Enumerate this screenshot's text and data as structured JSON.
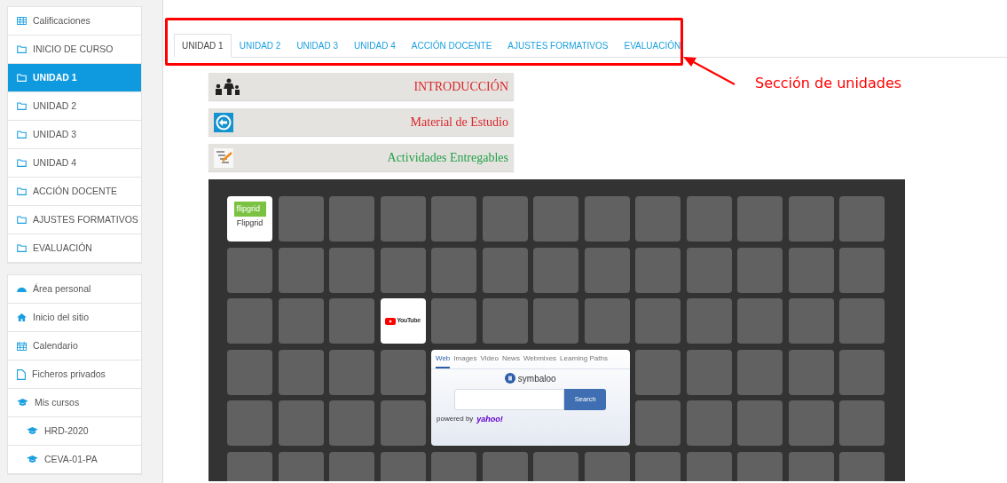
{
  "sidebar": {
    "groups": [
      {
        "items": [
          {
            "kind": "table",
            "label": "Calificaciones",
            "selected": false
          },
          {
            "kind": "folder",
            "label": "INICIO DE CURSO",
            "selected": false
          },
          {
            "kind": "folder",
            "label": "UNIDAD 1",
            "selected": true
          },
          {
            "kind": "folder",
            "label": "UNIDAD 2",
            "selected": false
          },
          {
            "kind": "folder",
            "label": "UNIDAD 3",
            "selected": false
          },
          {
            "kind": "folder",
            "label": "UNIDAD 4",
            "selected": false
          },
          {
            "kind": "folder",
            "label": "ACCIÓN DOCENTE",
            "selected": false
          },
          {
            "kind": "folder",
            "label": "AJUSTES FORMATIVOS",
            "selected": false
          },
          {
            "kind": "folder",
            "label": "EVALUACIÓN",
            "selected": false
          }
        ]
      },
      {
        "items": [
          {
            "kind": "dashboard",
            "label": "Área personal",
            "selected": false
          },
          {
            "kind": "home",
            "label": "Inicio del sitio",
            "selected": false
          },
          {
            "kind": "calendar",
            "label": "Calendario",
            "selected": false
          },
          {
            "kind": "file",
            "label": "Ficheros privados",
            "selected": false
          },
          {
            "kind": "cap",
            "label": "Mis cursos",
            "selected": false,
            "children": [
              {
                "kind": "cap",
                "label": "HRD-2020",
                "selected": false
              },
              {
                "kind": "cap",
                "label": "CEVA-01-PA",
                "selected": false
              }
            ]
          }
        ]
      }
    ]
  },
  "tabs": [
    {
      "label": "UNIDAD 1",
      "selected": true
    },
    {
      "label": "UNIDAD 2",
      "selected": false
    },
    {
      "label": "UNIDAD 3",
      "selected": false
    },
    {
      "label": "UNIDAD 4",
      "selected": false
    },
    {
      "label": "ACCIÓN DOCENTE",
      "selected": false
    },
    {
      "label": "AJUSTES FORMATIVOS",
      "selected": false
    },
    {
      "label": "EVALUACIÓN",
      "selected": false
    }
  ],
  "annotation": {
    "label": "Sección de unidades"
  },
  "banners": [
    {
      "kind": "people",
      "label": "INTRODUCCIÓN",
      "color": "#d9262c"
    },
    {
      "kind": "circle",
      "label": "Material de Estudio",
      "color": "#d9262c"
    },
    {
      "kind": "checklist",
      "label": "Actividades Entregables",
      "color": "#22a04b"
    }
  ],
  "tiles": [
    {
      "kind": "flipgrid",
      "logo": "flipgrid",
      "label": "Flipgrid"
    },
    {
      "kind": "empty"
    },
    {
      "kind": "empty"
    },
    {
      "kind": "empty"
    },
    {
      "kind": "empty"
    },
    {
      "kind": "empty"
    },
    {
      "kind": "empty"
    },
    {
      "kind": "empty"
    },
    {
      "kind": "empty"
    },
    {
      "kind": "empty"
    },
    {
      "kind": "empty"
    },
    {
      "kind": "empty"
    },
    {
      "kind": "empty"
    },
    {
      "kind": "empty"
    },
    {
      "kind": "empty"
    },
    {
      "kind": "empty"
    },
    {
      "kind": "empty"
    },
    {
      "kind": "empty"
    },
    {
      "kind": "empty"
    },
    {
      "kind": "empty"
    },
    {
      "kind": "empty"
    },
    {
      "kind": "empty"
    },
    {
      "kind": "empty"
    },
    {
      "kind": "empty"
    },
    {
      "kind": "empty"
    },
    {
      "kind": "empty"
    },
    {
      "kind": "empty"
    },
    {
      "kind": "empty"
    },
    {
      "kind": "empty"
    },
    {
      "kind": "youtube",
      "logo": "YouTube"
    },
    {
      "kind": "empty"
    },
    {
      "kind": "empty"
    },
    {
      "kind": "empty"
    },
    {
      "kind": "empty"
    },
    {
      "kind": "empty"
    },
    {
      "kind": "empty"
    },
    {
      "kind": "empty"
    },
    {
      "kind": "empty"
    },
    {
      "kind": "empty"
    },
    {
      "kind": "empty"
    },
    {
      "kind": "empty"
    },
    {
      "kind": "empty"
    },
    {
      "kind": "empty"
    },
    {
      "kind": "search",
      "tabs": [
        {
          "label": "Web",
          "selected": true
        },
        {
          "label": "Images",
          "selected": false
        },
        {
          "label": "Video",
          "selected": false
        },
        {
          "label": "News",
          "selected": false
        },
        {
          "label": "Webmixes",
          "selected": false
        },
        {
          "label": "Learning Paths",
          "selected": false
        }
      ],
      "logo": "symbaloo",
      "button": "Search",
      "powered": "powered by",
      "provider": "yahoo!"
    },
    {
      "kind": "empty"
    },
    {
      "kind": "empty"
    },
    {
      "kind": "empty"
    },
    {
      "kind": "empty"
    },
    {
      "kind": "empty"
    },
    {
      "kind": "empty"
    },
    {
      "kind": "empty"
    },
    {
      "kind": "empty"
    },
    {
      "kind": "empty"
    },
    {
      "kind": "empty"
    },
    {
      "kind": "empty"
    },
    {
      "kind": "empty"
    },
    {
      "kind": "empty"
    },
    {
      "kind": "empty"
    },
    {
      "kind": "empty"
    },
    {
      "kind": "empty"
    },
    {
      "kind": "empty"
    },
    {
      "kind": "empty"
    },
    {
      "kind": "empty"
    },
    {
      "kind": "empty"
    },
    {
      "kind": "empty"
    },
    {
      "kind": "empty"
    },
    {
      "kind": "empty"
    },
    {
      "kind": "empty"
    },
    {
      "kind": "empty"
    },
    {
      "kind": "empty"
    },
    {
      "kind": "empty"
    }
  ]
}
